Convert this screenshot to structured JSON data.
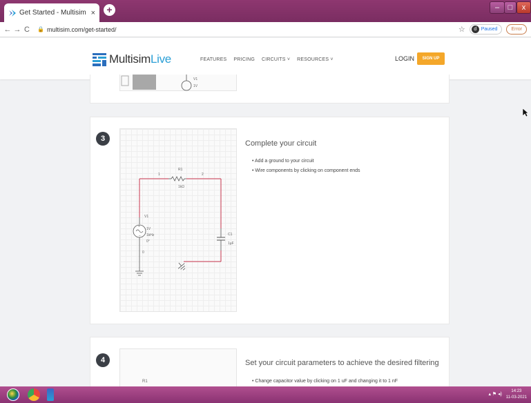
{
  "browser": {
    "tab_title": "Get Started - Multisim Liv",
    "tab_close": "×",
    "new_tab": "+",
    "back": "←",
    "forward": "→",
    "reload": "C",
    "url": "multisim.com/get-started/",
    "paused_label": "Paused",
    "profile_initial": "d",
    "error_label": "Error",
    "minimize": "–",
    "maximize": "□",
    "close": "x"
  },
  "header": {
    "logo_part1": "Multisim",
    "logo_part2": "Live",
    "nav": [
      "FEATURES",
      "PRICING",
      "CIRCUITS",
      "RESOURCES"
    ],
    "login": "LOGIN",
    "signup": "SIGN UP"
  },
  "prev_card": {
    "labels": [
      "V1",
      "1V"
    ]
  },
  "step3": {
    "number": "3",
    "title": "Complete your circuit",
    "bullets": [
      "Add a ground to your circuit",
      "Wire components by clicking on component ends"
    ],
    "schematic_labels": {
      "node1": "1",
      "node2": "2",
      "node0": "0",
      "r1": "R1",
      "r1_value": "1kΩ",
      "v1": "V1",
      "v1_amp": "1V",
      "v1_freq": "1kHz",
      "v1_phase": "0°",
      "c1": "C1",
      "c1_value": "1µF"
    }
  },
  "step4": {
    "number": "4",
    "title": "Set your circuit parameters to achieve the desired filtering",
    "bullets": [
      "Change capacitor value by clicking on 1 uF and changing it to 1 nF"
    ],
    "schematic_label": "R1"
  },
  "taskbar": {
    "time": "14:23",
    "date": "11-03-2021"
  },
  "colors": {
    "titlebar": "#7a2d61",
    "accent_orange": "#f4a72a",
    "logo_blue": "#2a9fd6",
    "wire_red": "#c8364e",
    "step_badge": "#3b3f46"
  }
}
